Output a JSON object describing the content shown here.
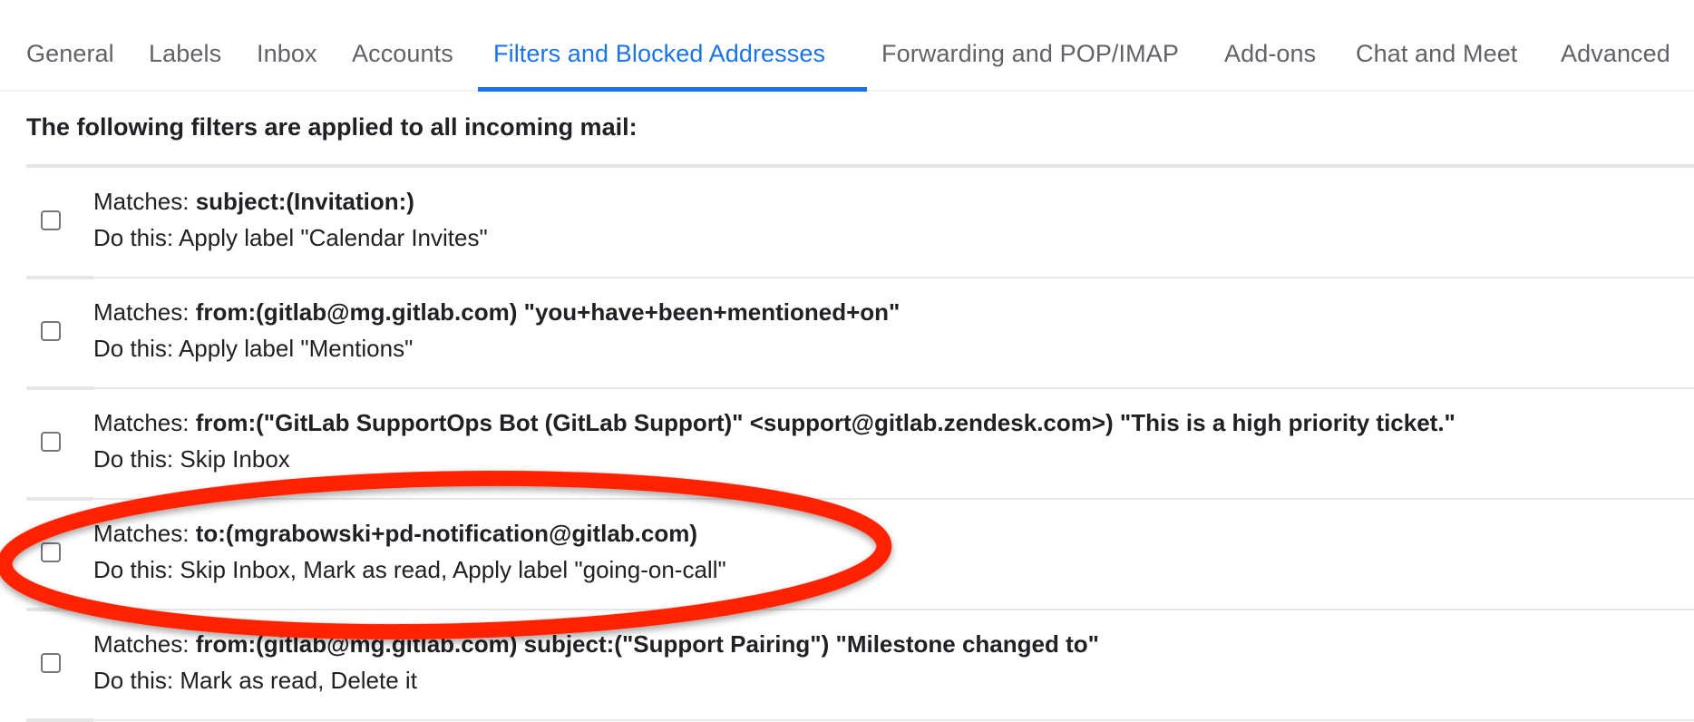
{
  "tabs": [
    {
      "label": "General",
      "active": false
    },
    {
      "label": "Labels",
      "active": false
    },
    {
      "label": "Inbox",
      "active": false
    },
    {
      "label": "Accounts",
      "active": false
    },
    {
      "label": "Filters and Blocked Addresses",
      "active": true
    },
    {
      "label": "Forwarding and POP/IMAP",
      "active": false
    },
    {
      "label": "Add-ons",
      "active": false
    },
    {
      "label": "Chat and Meet",
      "active": false
    },
    {
      "label": "Advanced",
      "active": false
    }
  ],
  "intro": "The following filters are applied to all incoming mail:",
  "labels": {
    "matches": "Matches: ",
    "do_this": "Do this: "
  },
  "filters": [
    {
      "criteria": "subject:(Invitation:)",
      "action": "Apply label \"Calendar Invites\"",
      "checked": false
    },
    {
      "criteria": "from:(gitlab@mg.gitlab.com) \"you+have+been+mentioned+on\"",
      "action": "Apply label \"Mentions\"",
      "checked": false
    },
    {
      "criteria": "from:(\"GitLab SupportOps Bot (GitLab Support)\" <support@gitlab.zendesk.com>) \"This is a high priority ticket.\"",
      "action": "Skip Inbox",
      "checked": false
    },
    {
      "criteria": "to:(mgrabowski+pd-notification@gitlab.com)",
      "action": "Skip Inbox, Mark as read, Apply label \"going-on-call\"",
      "checked": false,
      "highlighted": true
    },
    {
      "criteria": "from:(gitlab@mg.gitlab.com) subject:(\"Support Pairing\") \"Milestone changed to\"",
      "action": "Mark as read, Delete it",
      "checked": false
    }
  ],
  "colors": {
    "accent": "#1a73e8",
    "annotation": "#ff2200",
    "tab_text": "#5f6368",
    "text": "#202124",
    "divider": "#e6e6e6"
  }
}
